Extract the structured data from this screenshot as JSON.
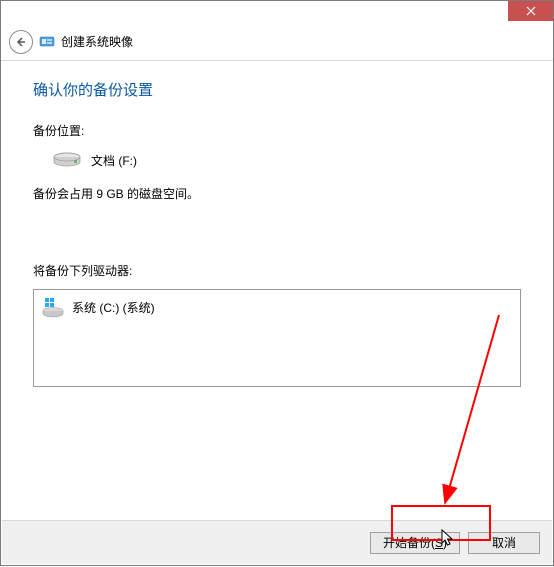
{
  "window": {
    "title": "创建系统映像"
  },
  "content": {
    "heading": "确认你的备份设置",
    "backup_location_label": "备份位置:",
    "backup_location_value": "文档 (F:)",
    "size_text": "备份会占用 9 GB 的磁盘空间。",
    "drives_label": "将备份下列驱动器:",
    "drive_value": "系统 (C:) (系统)"
  },
  "footer": {
    "start_label": "开始备份(",
    "start_accel": "S",
    "start_tail": ")",
    "cancel_label": "取消"
  }
}
